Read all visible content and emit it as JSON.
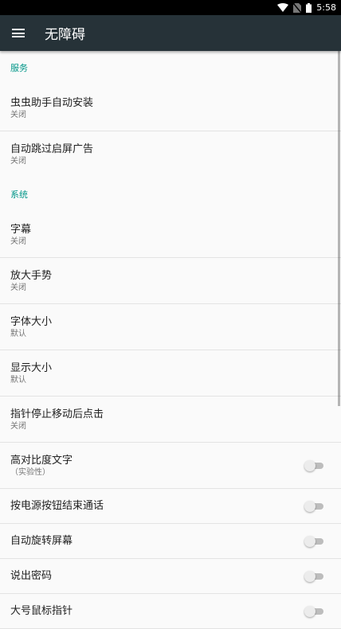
{
  "status_bar": {
    "time": "5:58"
  },
  "toolbar": {
    "menu_icon": "hamburger-menu-icon",
    "title": "无障碍"
  },
  "sections": [
    {
      "header": "服务",
      "items": [
        {
          "title": "虫虫助手自动安装",
          "summary": "关闭"
        },
        {
          "title": "自动跳过启屏广告",
          "summary": "关闭"
        }
      ]
    },
    {
      "header": "系统",
      "items": [
        {
          "title": "字幕",
          "summary": "关闭"
        },
        {
          "title": "放大手势",
          "summary": "关闭"
        },
        {
          "title": "字体大小",
          "summary": "默认"
        },
        {
          "title": "显示大小",
          "summary": "默认"
        },
        {
          "title": "指针停止移动后点击",
          "summary": "关闭"
        },
        {
          "title": "高对比度文字",
          "summary": "（实验性）",
          "switch": false
        },
        {
          "title": "按电源按钮结束通话",
          "switch": false
        },
        {
          "title": "自动旋转屏幕",
          "switch": false
        },
        {
          "title": "说出密码",
          "switch": false
        },
        {
          "title": "大号鼠标指针",
          "switch": false
        }
      ]
    }
  ],
  "colors": {
    "toolbar": "#263238",
    "accent": "#009688",
    "status_bar": "#000000"
  }
}
